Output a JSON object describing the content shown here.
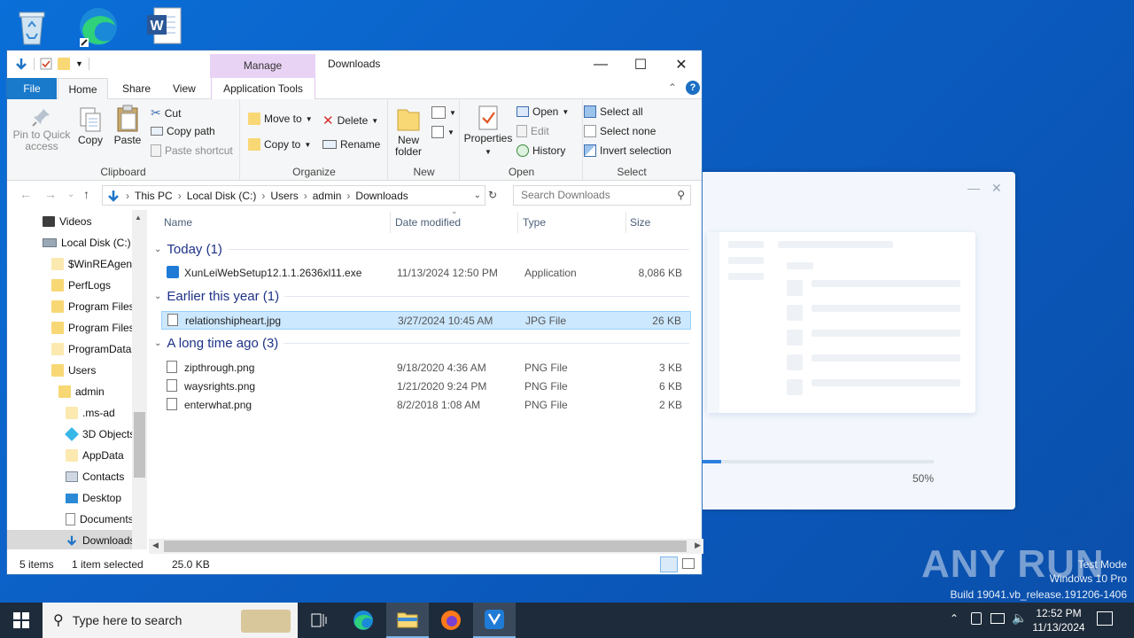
{
  "desktop": {
    "icons": [
      "recycle-bin-icon",
      "edge-icon",
      "word-icon"
    ]
  },
  "installer": {
    "progress_text": "50%",
    "progress": 0.5
  },
  "explorer": {
    "title": "Downloads",
    "manage_tab": "Manage",
    "tabs": [
      "File",
      "Home",
      "Share",
      "View",
      "Application Tools"
    ],
    "ribbon": {
      "clipboard": {
        "pin": "Pin to Quick access",
        "copy": "Copy",
        "paste": "Paste",
        "cut": "Cut",
        "copy_path": "Copy path",
        "paste_shortcut": "Paste shortcut",
        "label": "Clipboard"
      },
      "organize": {
        "move_to": "Move to",
        "copy_to": "Copy to",
        "delete": "Delete",
        "rename": "Rename",
        "label": "Organize"
      },
      "new": {
        "new_folder": "New folder",
        "label": "New"
      },
      "open": {
        "properties": "Properties",
        "open": "Open",
        "edit": "Edit",
        "history": "History",
        "label": "Open"
      },
      "select": {
        "select_all": "Select all",
        "select_none": "Select none",
        "invert": "Invert selection",
        "label": "Select"
      }
    },
    "address": {
      "crumbs": [
        "This PC",
        "Local Disk (C:)",
        "Users",
        "admin",
        "Downloads"
      ],
      "search_placeholder": "Search Downloads"
    },
    "nav": [
      {
        "label": "Videos"
      },
      {
        "label": "Local Disk (C:)"
      },
      {
        "label": "$WinREAgent"
      },
      {
        "label": "PerfLogs"
      },
      {
        "label": "Program Files"
      },
      {
        "label": "Program Files"
      },
      {
        "label": "ProgramData"
      },
      {
        "label": "Users"
      },
      {
        "label": "admin"
      },
      {
        "label": ".ms-ad"
      },
      {
        "label": "3D Objects"
      },
      {
        "label": "AppData"
      },
      {
        "label": "Contacts"
      },
      {
        "label": "Desktop"
      },
      {
        "label": "Documents"
      },
      {
        "label": "Downloads"
      }
    ],
    "columns": [
      "Name",
      "Date modified",
      "Type",
      "Size"
    ],
    "groups": [
      {
        "title": "Today (1)",
        "files": [
          {
            "name": "XunLeiWebSetup12.1.1.2636xl11.exe",
            "date": "11/13/2024 12:50 PM",
            "type": "Application",
            "size": "8,086 KB"
          }
        ]
      },
      {
        "title": "Earlier this year (1)",
        "files": [
          {
            "name": "relationshipheart.jpg",
            "date": "3/27/2024 10:45 AM",
            "type": "JPG File",
            "size": "26 KB"
          }
        ]
      },
      {
        "title": "A long time ago (3)",
        "files": [
          {
            "name": "zipthrough.png",
            "date": "9/18/2020 4:36 AM",
            "type": "PNG File",
            "size": "3 KB"
          },
          {
            "name": "waysrights.png",
            "date": "1/21/2020 9:24 PM",
            "type": "PNG File",
            "size": "6 KB"
          },
          {
            "name": "enterwhat.png",
            "date": "8/2/2018 1:08 AM",
            "type": "PNG File",
            "size": "2 KB"
          }
        ]
      }
    ],
    "status": {
      "items": "5 items",
      "selected": "1 item selected",
      "size": "25.0 KB"
    }
  },
  "taskbar": {
    "search_placeholder": "Type here to search",
    "time": "12:52 PM",
    "date": "11/13/2024"
  },
  "watermark": {
    "logo": "ANY RUN",
    "line1": "Test Mode",
    "line2": "Windows 10 Pro",
    "line3": "Build 19041.vb_release.191206-1406"
  }
}
